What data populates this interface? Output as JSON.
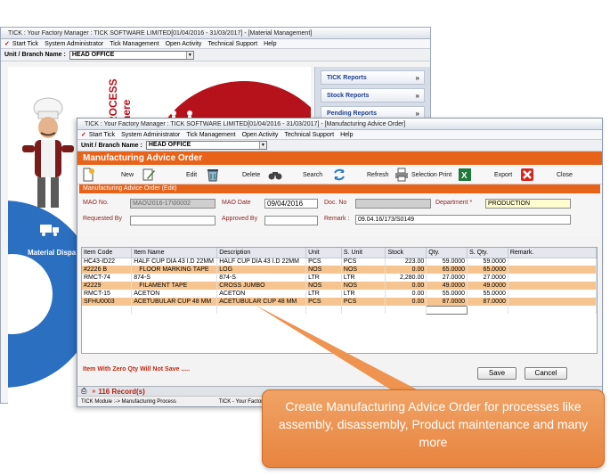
{
  "back_window": {
    "title": "TICK : Your Factory Manager : TICK SOFTWARE LIMITED[01/04/2016 - 31/03/2017] - [Material Management]",
    "menu": [
      "Start Tick",
      "System Administrator",
      "Tick Management",
      "Open Activity",
      "Technical Support",
      "Help"
    ],
    "unit_label": "Unit / Branch Name :",
    "unit_value": "HEAD OFFICE",
    "splash_text": "PROCESS\ns here",
    "material_label": "Material Dispa",
    "side_buttons": [
      "TICK Reports",
      "Stock Reports",
      "Pending Reports"
    ]
  },
  "front_window": {
    "title": "TICK : Your Factory Manager : TICK SOFTWARE LIMITED[01/04/2016 - 31/03/2017] - [Manufacturing Advice Order]",
    "menu": [
      "Start Tick",
      "System Administrator",
      "Tick Management",
      "Open Activity",
      "Technical Support",
      "Help"
    ],
    "unit_label": "Unit / Branch Name :",
    "unit_value": "HEAD OFFICE",
    "form_title": "Manufacturing Advice Order",
    "toolbar": {
      "new": "New",
      "edit": "Edit",
      "delete": "Delete",
      "search": "Search",
      "refresh": "Refresh",
      "selection_print": "Selection Print",
      "export": "Export",
      "close": "Close"
    },
    "section_title": "Manufacturing Advice Order (Edit)",
    "fields": {
      "mao_no_label": "MAO No.",
      "mao_no_value": "MAO\\2016-17\\00002",
      "mao_date_label": "MAO Date",
      "mao_date_value": "09/04/2016",
      "doc_no_label": "Doc. No",
      "doc_no_value": "",
      "department_label": "Department *",
      "department_value": "PRODUCTION",
      "requested_by_label": "Requested By",
      "requested_by_value": "",
      "approved_by_label": "Approved By",
      "approved_by_value": "",
      "remark_label": "Remark :",
      "remark_value": "09.04.16/173/S0149"
    },
    "grid": {
      "columns": [
        "Item Code",
        "Item Name",
        "Description",
        "Unit",
        "S. Unit",
        "Stock",
        "Qty.",
        "S. Qty.",
        "Remark."
      ],
      "rows": [
        [
          "HC43-ID22",
          "HALF CUP DIA 43 I.D 22MM",
          "HALF CUP DIA 43 I.D 22MM",
          "PCS",
          "PCS",
          "223.00",
          "59.0000",
          "59.0000",
          ""
        ],
        [
          "#2226 B",
          "FLOOR MARKING TAPE",
          "LOG",
          "NOS",
          "NOS",
          "0.00",
          "65.0000",
          "65.0000",
          ""
        ],
        [
          "RMCT-74",
          "874-S",
          "874-S",
          "LTR",
          "LTR",
          "2,280.00",
          "27.0000",
          "27.0000",
          ""
        ],
        [
          "#2229",
          "FILAMENT TAPE",
          "CROSS JUMBO",
          "NOS",
          "NOS",
          "0.00",
          "49.0000",
          "49.0000",
          ""
        ],
        [
          "RMCT-15",
          "ACETON",
          "ACETON",
          "LTR",
          "LTR",
          "0.00",
          "55.0000",
          "55.0000",
          ""
        ],
        [
          "SFHU0003",
          "ACETUBULAR CUP 48 MM",
          "ACETUBULAR CUP 48 MM",
          "PCS",
          "PCS",
          "0.00",
          "87.0000",
          "87.0000",
          ""
        ]
      ]
    },
    "warning": "Item With Zero Qty Will Not Save .....",
    "save_label": "Save",
    "cancel_label": "Cancel",
    "record_count": "116 Record(s)",
    "footer_left": "TICK Module :-> Manufacturing Process",
    "footer_right": "TICK - Your Factory Your"
  },
  "callout_text": "Create Manufacturing Advice Order for processes like assembly, disassembly,  Product maintenance and many more",
  "colors": {
    "header_orange": "#e8631a",
    "row_highlight": "#f6c58f",
    "callout": "#e8843f",
    "brand_red": "#b6121b",
    "brand_blue": "#2b6fc0"
  },
  "icons": {
    "new": "new-document-icon",
    "edit": "edit-pencil-icon",
    "delete": "recycle-bin-icon",
    "search": "binoculars-icon",
    "refresh": "refresh-arrows-icon",
    "selection_print": "printer-icon",
    "export": "excel-export-icon",
    "close": "close-x-icon"
  }
}
